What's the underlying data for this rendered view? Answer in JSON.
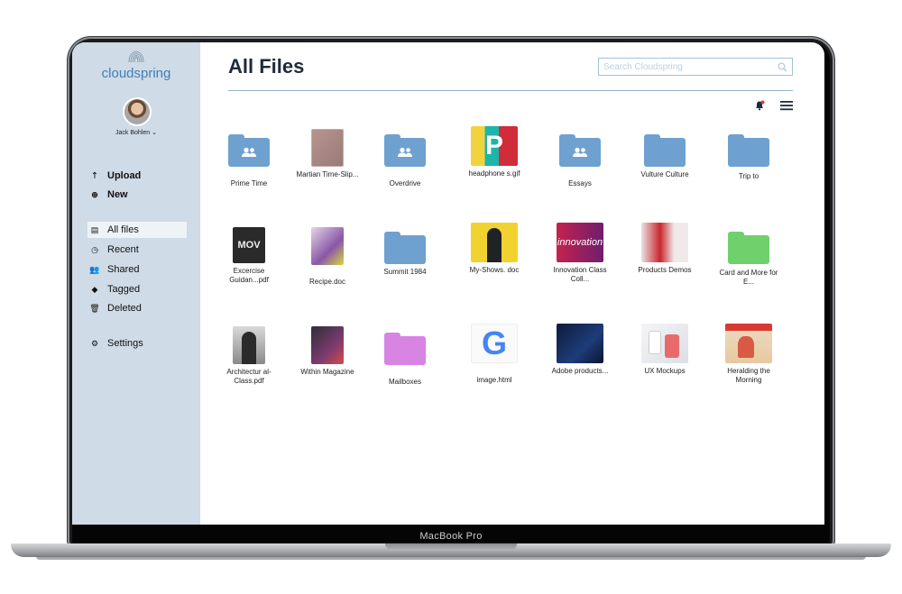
{
  "device": {
    "label": "MacBook Pro"
  },
  "app": {
    "brand": "cloudspring",
    "page_title": "All Files"
  },
  "user": {
    "name": "Jack Bohlen ⌄"
  },
  "search": {
    "placeholder": "Search Cloudspring"
  },
  "colors": {
    "sidebar_bg": "#cfdbe6",
    "accent": "#3f7fb8",
    "folder_blue": "#6fa1d0",
    "folder_green": "#6fd16b",
    "folder_purple": "#d784e3",
    "notification": "#e53935"
  },
  "sidebar": {
    "actions": [
      {
        "label": "Upload",
        "icon": "upload-arrow-icon"
      },
      {
        "label": "New",
        "icon": "plus-circle-icon"
      }
    ],
    "items": [
      {
        "label": "All files",
        "icon": "files-icon"
      },
      {
        "label": "Recent",
        "icon": "clock-icon"
      },
      {
        "label": "Shared",
        "icon": "users-icon"
      },
      {
        "label": "Tagged",
        "icon": "tag-icon"
      },
      {
        "label": "Deleted",
        "icon": "trash-icon"
      }
    ],
    "settings": {
      "label": "Settings",
      "icon": "gear-icon"
    }
  },
  "files": [
    {
      "name": "Prime Time",
      "kind": "shared-folder"
    },
    {
      "name": "Martian Time-Slip...",
      "kind": "document"
    },
    {
      "name": "Overdrive",
      "kind": "shared-folder"
    },
    {
      "name": "headphone s.gif",
      "kind": "image"
    },
    {
      "name": "Essays",
      "kind": "shared-folder"
    },
    {
      "name": "Vulture Culture",
      "kind": "folder"
    },
    {
      "name": "Trip to",
      "kind": "folder"
    },
    {
      "name": "Excercise Guidan...pdf",
      "kind": "image"
    },
    {
      "name": "Recipe.doc",
      "kind": "image"
    },
    {
      "name": "Summit 1984",
      "kind": "folder"
    },
    {
      "name": "My-Shows. doc",
      "kind": "image"
    },
    {
      "name": "Innovation Class Coll...",
      "kind": "image"
    },
    {
      "name": "Products Demos",
      "kind": "image"
    },
    {
      "name": "Card and More for E...",
      "kind": "folder-green"
    },
    {
      "name": "Architectur al-Class.pdf",
      "kind": "image"
    },
    {
      "name": "Within Magazine",
      "kind": "image"
    },
    {
      "name": "Mailboxes",
      "kind": "folder-purple"
    },
    {
      "name": "image.html",
      "kind": "image"
    },
    {
      "name": "Adobe products...",
      "kind": "image"
    },
    {
      "name": "UX Mockups",
      "kind": "image"
    },
    {
      "name": "Heralding the Morning",
      "kind": "image"
    }
  ],
  "thumb_text": {
    "headphones": "P",
    "exercise": "MOV",
    "innovation": "innovation",
    "google": "G"
  }
}
